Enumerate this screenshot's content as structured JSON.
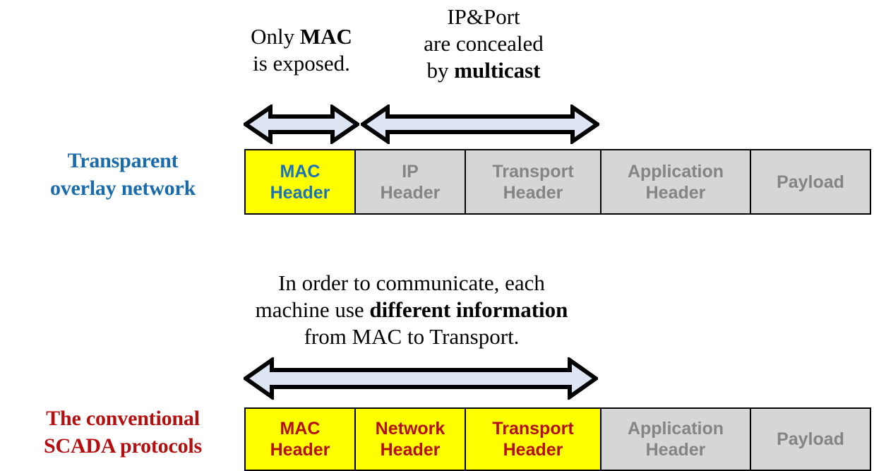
{
  "diagram": {
    "title_hidden": "Packet header exposure comparison",
    "colors": {
      "accent_blue": "#1a6bab",
      "accent_red": "#b50e0e",
      "cell_yellow": "#ffff00",
      "cell_gray": "#d6d6d6",
      "text_gray": "#848484",
      "text_blue": "#1a72b8",
      "arrow_fill": "#dde4f2",
      "arrow_stroke": "#000000"
    }
  },
  "sections": {
    "top": {
      "label_line1": "Transparent",
      "label_line2": "overlay network",
      "captions": {
        "mac_line1": "Only ",
        "mac_bold": "MAC",
        "mac_line2": "is exposed.",
        "ipport_line1": "IP&Port",
        "ipport_line2": "are concealed",
        "ipport_line3_prefix": "by ",
        "ipport_bold": "multicast"
      },
      "arrows": [
        {
          "name": "mac-span-arrow",
          "span": "MAC Header"
        },
        {
          "name": "ip-transport-application-span-arrow",
          "span": "IP to Application Header"
        }
      ],
      "packet": {
        "cells": [
          {
            "line1": "MAC",
            "line2": "Header",
            "fill": "yellow",
            "text": "blue"
          },
          {
            "line1": "IP",
            "line2": "Header",
            "fill": "gray",
            "text": "gray"
          },
          {
            "line1": "Transport",
            "line2": "Header",
            "fill": "gray",
            "text": "gray"
          },
          {
            "line1": "Application",
            "line2": "Header",
            "fill": "gray",
            "text": "gray"
          },
          {
            "line1": "Payload",
            "line2": "",
            "fill": "gray",
            "text": "gray"
          }
        ]
      }
    },
    "bottom": {
      "label_line1": "The conventional",
      "label_line2": "SCADA protocols",
      "captions": {
        "line1": "In order to communicate, each",
        "line2_prefix": "machine use ",
        "line2_bold": "different information",
        "line3": "from MAC to Transport."
      },
      "arrows": [
        {
          "name": "mac-to-transport-span-arrow",
          "span": "MAC Header to Transport Header"
        }
      ],
      "packet": {
        "cells": [
          {
            "line1": "MAC",
            "line2": "Header",
            "fill": "yellow",
            "text": "red"
          },
          {
            "line1": "Network",
            "line2": "Header",
            "fill": "yellow",
            "text": "red"
          },
          {
            "line1": "Transport",
            "line2": "Header",
            "fill": "yellow",
            "text": "red"
          },
          {
            "line1": "Application",
            "line2": "Header",
            "fill": "gray",
            "text": "gray"
          },
          {
            "line1": "Payload",
            "line2": "",
            "fill": "gray",
            "text": "gray"
          }
        ]
      }
    }
  }
}
